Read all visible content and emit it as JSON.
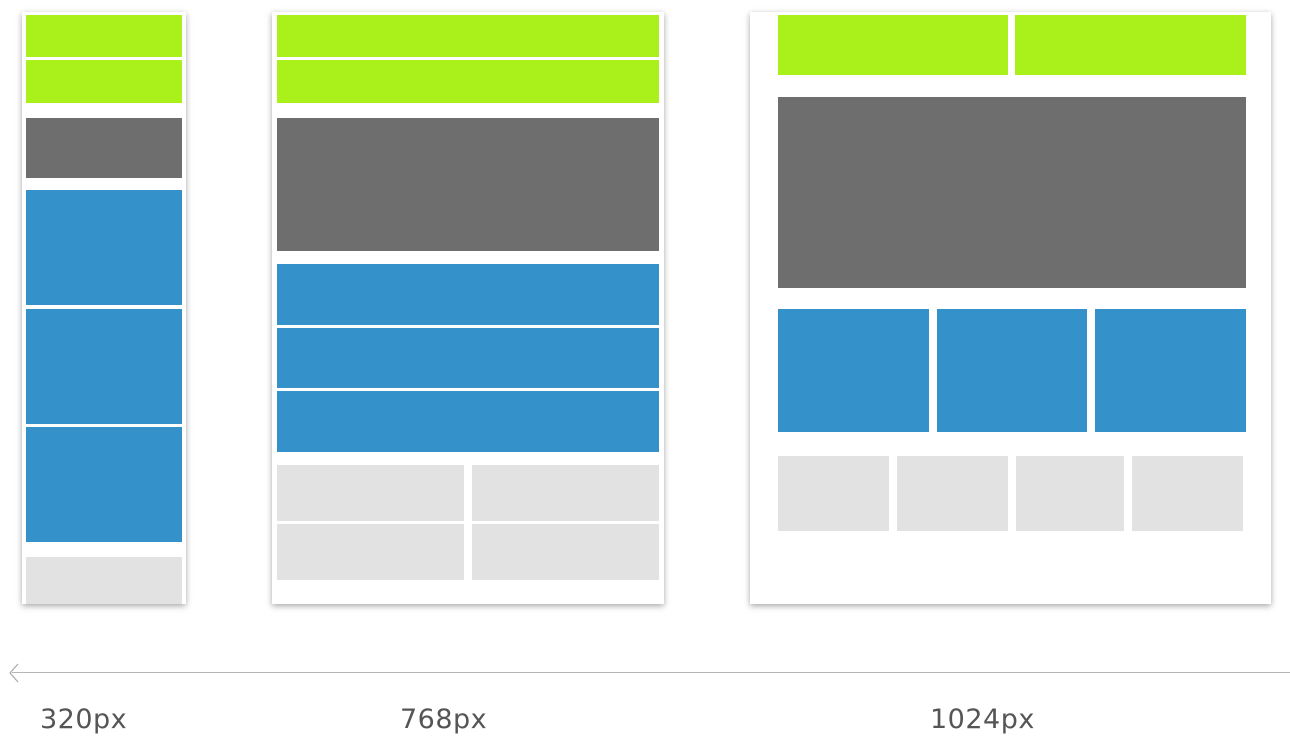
{
  "colors": {
    "header": "#aaf01b",
    "hero": "#6e6e6e",
    "content": "#3591c9",
    "footer": "#e2e2e2",
    "axis": "#b5b5b5",
    "label_text": "#555555"
  },
  "breakpoints": [
    {
      "label": "320px"
    },
    {
      "label": "768px"
    },
    {
      "label": "1024px"
    }
  ],
  "axis": {
    "arrow_direction": "left"
  }
}
